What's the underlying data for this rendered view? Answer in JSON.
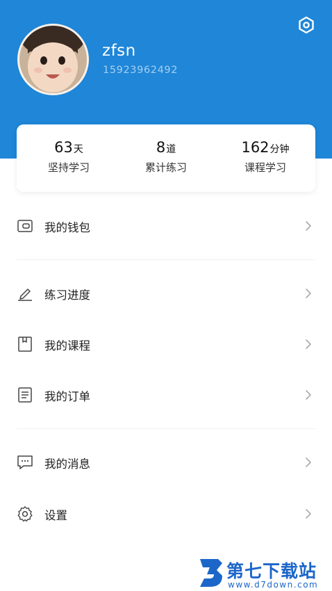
{
  "colors": {
    "header_blue": "#1f86d8",
    "watermark_blue": "#1c66c9"
  },
  "profile": {
    "username": "zfsn",
    "phone": "15923962492",
    "avatar_icon": "child-avatar-photo",
    "settings_icon": "hexagon-settings-icon"
  },
  "stats": [
    {
      "value": "63",
      "unit": "天",
      "label": "坚持学习"
    },
    {
      "value": "8",
      "unit": "道",
      "label": "累计练习"
    },
    {
      "value": "162",
      "unit": "分钟",
      "label": "课程学习"
    }
  ],
  "menu": [
    {
      "label": "我的钱包",
      "icon": "wallet-icon"
    },
    {
      "label": "练习进度",
      "icon": "pencil-icon"
    },
    {
      "label": "我的课程",
      "icon": "book-icon"
    },
    {
      "label": "我的订单",
      "icon": "document-icon"
    },
    {
      "label": "我的消息",
      "icon": "message-icon"
    },
    {
      "label": "设置",
      "icon": "gear-icon"
    }
  ],
  "watermark": {
    "title": "第七下载站",
    "url": "www.d7down.com"
  }
}
